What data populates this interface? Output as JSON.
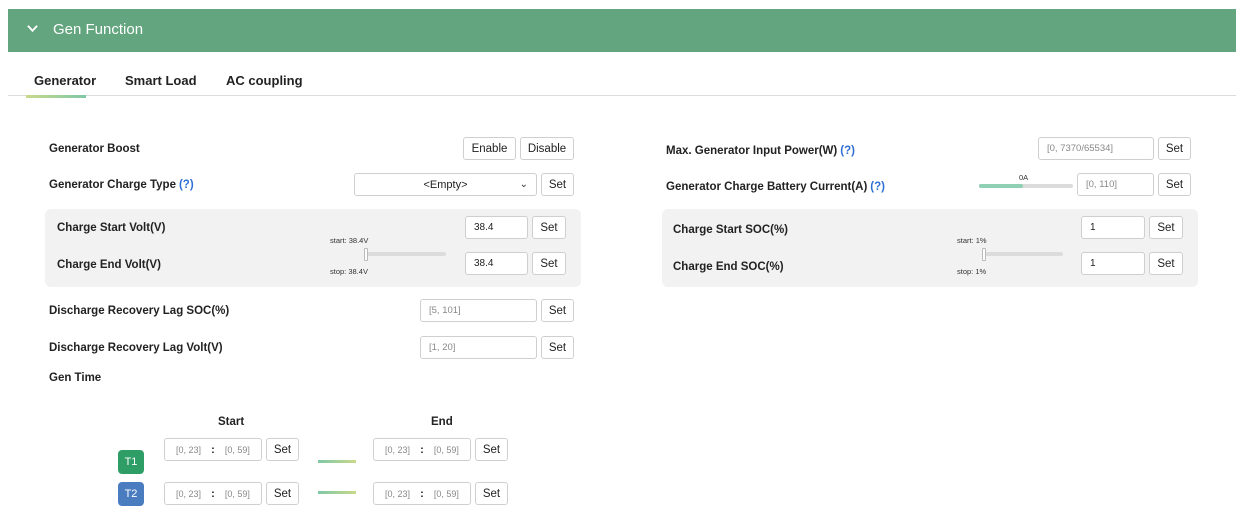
{
  "section": {
    "title": "Gen Function"
  },
  "tabs": [
    "Generator",
    "Smart Load",
    "AC coupling"
  ],
  "left": {
    "generator_boost": {
      "label": "Generator Boost",
      "enable": "Enable",
      "disable": "Disable"
    },
    "charge_type": {
      "label": "Generator Charge Type",
      "help": "(?)",
      "selected": "<Empty>",
      "set": "Set"
    },
    "volt_panel": {
      "start_label": "Charge Start Volt(V)",
      "end_label": "Charge End Volt(V)",
      "start_value": "38.4",
      "end_value": "38.4",
      "slider_start": "start: 38.4V",
      "slider_stop": "stop: 38.4V",
      "set": "Set"
    },
    "lag_soc": {
      "label": "Discharge Recovery Lag SOC(%)",
      "placeholder": "[5, 101]",
      "set": "Set"
    },
    "lag_volt": {
      "label": "Discharge Recovery Lag Volt(V)",
      "placeholder": "[1, 20]",
      "set": "Set"
    },
    "gen_time": {
      "label": "Gen Time",
      "start_header": "Start",
      "end_header": "End",
      "rows": [
        {
          "badge": "T1",
          "color": "#2e9e66",
          "hour": "[0, 23]",
          "sep": ":",
          "min": "[0, 59]",
          "set": "Set"
        },
        {
          "badge": "T2",
          "color": "#4a7cc0",
          "hour": "[0, 23]",
          "sep": ":",
          "min": "[0, 59]",
          "set": "Set"
        }
      ]
    }
  },
  "right": {
    "max_power": {
      "label": "Max. Generator Input Power(W)",
      "help": "(?)",
      "placeholder": "[0, 7370/65534]",
      "set": "Set"
    },
    "battery_current": {
      "label": "Generator Charge Battery Current(A)",
      "help": "(?)",
      "slider_value": "0A",
      "placeholder": "[0, 110]",
      "set": "Set"
    },
    "soc_panel": {
      "start_label": "Charge Start SOC(%)",
      "end_label": "Charge End SOC(%)",
      "start_value": "1",
      "end_value": "1",
      "slider_start": "start: 1%",
      "slider_stop": "stop: 1%",
      "set": "Set"
    }
  },
  "colors": {
    "header": "#63a57e",
    "t1": "#2e9e66",
    "t2": "#4a7cc0",
    "help": "#2f6fd6"
  },
  "icons": {
    "collapse": "chevron-down-icon",
    "select": "caret-down-icon"
  }
}
